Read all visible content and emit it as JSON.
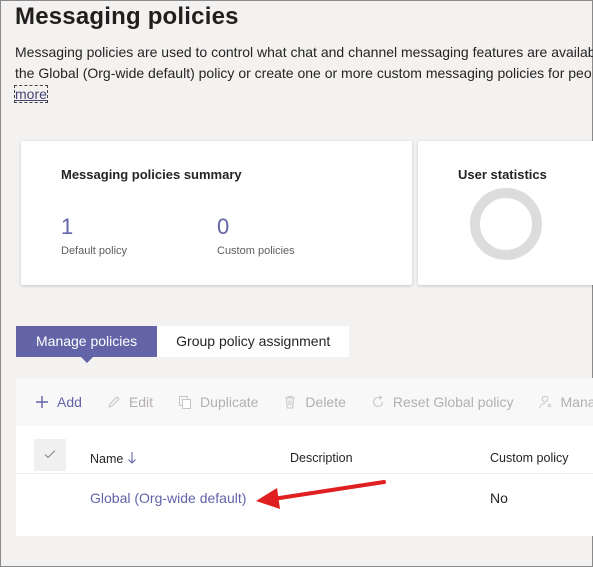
{
  "page": {
    "title": "Messaging policies",
    "description_line1": "Messaging policies are used to control what chat and channel messaging features are availab",
    "description_line2": "the Global (Org-wide default) policy or create one or more custom messaging policies for peo",
    "more_link": "more"
  },
  "summary_card": {
    "title": "Messaging policies summary",
    "stats": [
      {
        "value": "1",
        "label": "Default policy"
      },
      {
        "value": "0",
        "label": "Custom policies"
      }
    ]
  },
  "stats_card": {
    "title": "User statistics"
  },
  "tabs": [
    {
      "label": "Manage policies",
      "active": true
    },
    {
      "label": "Group policy assignment",
      "active": false
    }
  ],
  "toolbar": {
    "add": "Add",
    "edit": "Edit",
    "duplicate": "Duplicate",
    "delete": "Delete",
    "reset": "Reset Global policy",
    "manage": "Mana"
  },
  "table": {
    "columns": {
      "name": "Name",
      "description": "Description",
      "custom_policy": "Custom policy"
    },
    "rows": [
      {
        "name": "Global (Org-wide default)",
        "description": "",
        "custom_policy": "No"
      }
    ]
  },
  "colors": {
    "accent": "#6264a7",
    "annotation_arrow": "#e02020"
  },
  "icons": [
    "plus-icon",
    "pencil-icon",
    "duplicate-icon",
    "trash-icon",
    "reset-icon",
    "manage-users-icon",
    "checkmark-icon",
    "sort-down-arrow-icon",
    "red-annotation-arrow"
  ]
}
